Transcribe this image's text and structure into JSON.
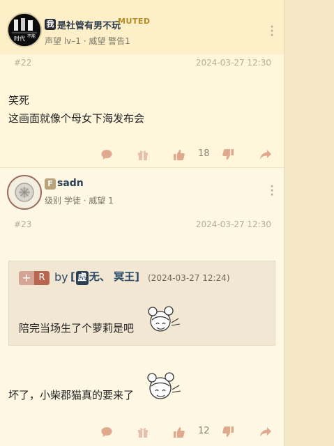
{
  "posts": [
    {
      "username": "是社管有男不玩",
      "badge": "我",
      "tag": "MUTED",
      "meta": "声望 lv–1 · 威望 警告1",
      "floor": "#22",
      "time": "2024-03-27 12:30",
      "content_lines": [
        "笑死",
        "这画面就像个母女下海发布会"
      ],
      "like_count": "18"
    },
    {
      "username": "sadn",
      "badge": "F",
      "meta": "级别 学徒 · 威望 1",
      "floor": "#23",
      "time": "2024-03-27 12:30",
      "quote": {
        "plus": "+",
        "reply_tag": "R",
        "by": "by",
        "name_open": "[",
        "name_badge": "虚",
        "name_rest": "无、 冥王]",
        "time": "(2024-03-27 12:24)",
        "text": "陪完当场生了个萝莉是吧"
      },
      "content": "坏了，小柴郡猫真的要来了",
      "like_count": "12"
    }
  ],
  "avatar1_text": {
    "line1": "时代",
    "line2": "不能"
  },
  "colors": {
    "accent": "#2b4a68",
    "muted_tag": "#b58a23",
    "reply_tag": "#b9664f"
  },
  "icons": [
    "comment-icon",
    "gift-icon",
    "thumbs-up-icon",
    "thumbs-down-icon",
    "share-icon",
    "more-vertical-icon"
  ]
}
